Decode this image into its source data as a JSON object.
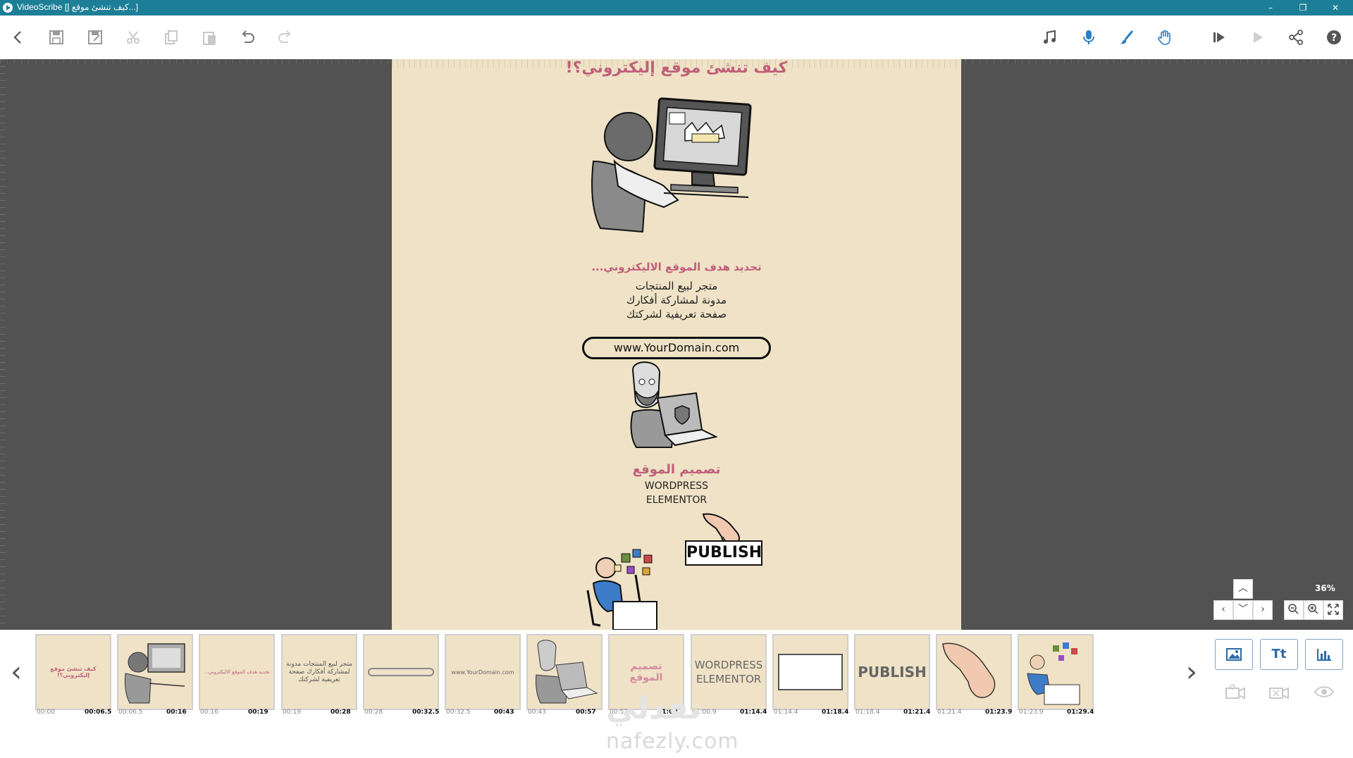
{
  "window": {
    "title": "VideoScribe [كيف تنشئ موقع إ...]",
    "controls": [
      "–",
      "❐",
      "✕"
    ]
  },
  "toolbar": {
    "left": [
      "back-icon",
      "save-icon",
      "save-as-icon",
      "cut-icon",
      "copy-icon",
      "paste-icon",
      "undo-icon",
      "redo-icon"
    ],
    "right": [
      "music-icon",
      "microphone-icon",
      "brush-icon",
      "hand-icon",
      "preview-from-icon",
      "play-icon",
      "share-icon",
      "help-icon"
    ]
  },
  "canvas": {
    "title": "كيف تنشئ موقع إليكتروني؟!",
    "subtitle": "تحديد هدف الموقع الاليكتروني...",
    "goals": [
      "متجر لبيع المنتجات",
      "مدونة لمشاركة أفكارك",
      "صفحة تعريفية لشركتك"
    ],
    "domain": "www.YourDomain.com",
    "design_heading": "تصميم الموقع",
    "design_tools": [
      "WORDPRESS",
      "ELEMENTOR"
    ],
    "publish": "PUBLISH"
  },
  "zoom": {
    "level": "36%"
  },
  "timeline": {
    "items": [
      {
        "label": "كيف تنشئ موقع إليكتروني؟!",
        "kind": "text-pink",
        "start": "00:00",
        "end": "00:06.5"
      },
      {
        "label": "",
        "kind": "image-computer",
        "start": "00:06.5",
        "end": "00:16"
      },
      {
        "label": "تحديد هدف الموقع الاليكتروني...",
        "kind": "text-pink-small",
        "start": "00:16",
        "end": "00:19"
      },
      {
        "label": "متجر لبيع المنتجات مدونة لمشاركة أفكارك صفحة تعريفية لشركتك",
        "kind": "text-dark",
        "start": "00:19",
        "end": "00:28"
      },
      {
        "label": "",
        "kind": "shape-pill",
        "start": "00:28",
        "end": "00:32.5"
      },
      {
        "label": "www.YourDomain.com",
        "kind": "text-small",
        "start": "00:32.5",
        "end": "00:43"
      },
      {
        "label": "",
        "kind": "image-laptop",
        "start": "00:43",
        "end": "00:57"
      },
      {
        "label": "تصميم الموقع",
        "kind": "text-pink-big",
        "start": "00:57",
        "end": "01:00.9"
      },
      {
        "label": "WORDPRESS ELEMENTOR",
        "kind": "text-latin",
        "start": "01:00.9",
        "end": "01:14.4"
      },
      {
        "label": "",
        "kind": "shape-rect",
        "start": "01:14.4",
        "end": "01:18.4"
      },
      {
        "label": "PUBLISH",
        "kind": "text-publish",
        "start": "01:18.4",
        "end": "01:21.4"
      },
      {
        "label": "",
        "kind": "image-hand",
        "start": "01:21.4",
        "end": "01:23.9"
      },
      {
        "label": "",
        "kind": "image-desk",
        "start": "01:23.9",
        "end": "01:29.4"
      }
    ],
    "add_buttons": [
      "image-icon",
      "Tt",
      "chart-icon"
    ],
    "dim_buttons": [
      "camera-add-icon",
      "camera-remove-icon",
      "visibility-icon"
    ]
  },
  "watermark": {
    "latin": "nafezly.com",
    "arabic": "نفذلي"
  },
  "colors": {
    "titlebar": "#1d7f97",
    "workspace": "#525252",
    "canvas": "#efe2c6",
    "accent_pink": "#c05f7a",
    "accent_blue": "#2c6aa6"
  }
}
